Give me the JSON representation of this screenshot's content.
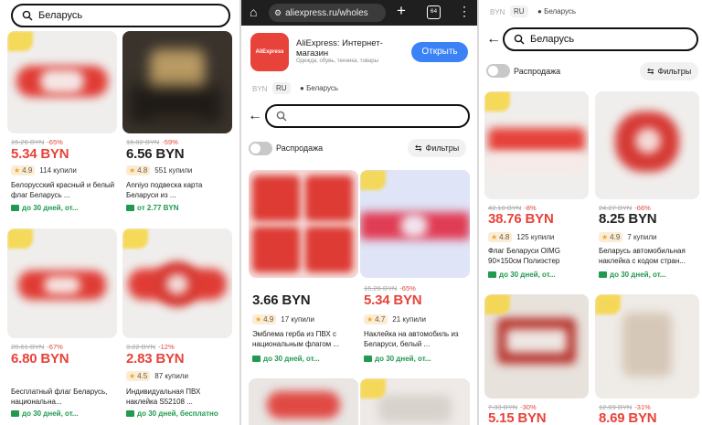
{
  "left": {
    "search_query": "Беларусь",
    "products": [
      {
        "old_price": "15.26 BYN",
        "discount": "-65%",
        "price": "5.34 BYN",
        "price_red": true,
        "rating": "4.9",
        "sold": "114 купили",
        "title": "Белорусский красный и белый флаг Беларусь ...",
        "shipping": "до 30 дней, от..."
      },
      {
        "old_price": "16.02 BYN",
        "discount": "-59%",
        "price": "6.56 BYN",
        "price_red": false,
        "rating": "4.8",
        "sold": "551 купили",
        "title": "Anniyo подвеска карта Беларуси из ...",
        "shipping": "от 2.77 BYN"
      },
      {
        "old_price": "20.61 BYN",
        "discount": "-67%",
        "price": "6.80 BYN",
        "price_red": true,
        "rating": "",
        "sold": "",
        "title": "Бесплатный флаг Беларусь, национальна...",
        "shipping": "до 30 дней, от..."
      },
      {
        "old_price": "3.22 BYN",
        "discount": "-12%",
        "price": "2.83 BYN",
        "price_red": true,
        "rating": "4.5",
        "sold": "87 купили",
        "title": "Индивидуальная ПВХ наклейка S52108 ...",
        "shipping": "до 30 дней, бесплатно"
      }
    ]
  },
  "middle": {
    "browser": {
      "url": "aliexpress.ru/wholes",
      "tab_count": "64"
    },
    "banner": {
      "logo_text": "AliExpress",
      "title": "AliExpress: Интернет-магазин",
      "subtitle": "Одежда, обувь, техника, товары",
      "open_label": "Открыть"
    },
    "region": {
      "currency": "BYN",
      "language": "RU",
      "country": "Беларусь"
    },
    "search_value": "",
    "sale_label": "Распродажа",
    "filters_label": "Фильтры",
    "products": [
      {
        "old_price": "",
        "discount": "",
        "price": "3.66 BYN",
        "price_red": false,
        "rating": "4.9",
        "sold": "17 купили",
        "title": "Эмблема герба из ПВХ с национальным флагом ...",
        "shipping": "до 30 дней, от..."
      },
      {
        "old_price": "15.26 BYN",
        "discount": "-65%",
        "price": "5.34 BYN",
        "price_red": true,
        "rating": "4.7",
        "sold": "21 купили",
        "title": "Наклейка на автомобиль из Беларуси, белый ...",
        "shipping": "до 30 дней, от..."
      }
    ]
  },
  "right": {
    "region": {
      "currency": "BYN",
      "language": "RU",
      "country": "Беларусь"
    },
    "search_query": "Беларусь",
    "sale_label": "Распродажа",
    "filters_label": "Фильтры",
    "products": [
      {
        "old_price": "42.10 BYN",
        "discount": "-8%",
        "price": "38.76 BYN",
        "price_red": true,
        "rating": "4.8",
        "sold": "125 купили",
        "title": "Флаг Беларуси OIMG 90×150см Полиэстер",
        "shipping": "до 30 дней, от..."
      },
      {
        "old_price": "24.27 BYN",
        "discount": "-66%",
        "price": "8.25 BYN",
        "price_red": false,
        "rating": "4.9",
        "sold": "7 купили",
        "title": "Беларусь автомобильная наклейка с кодом стран...",
        "shipping": "до 30 дней, от..."
      },
      {
        "old_price": "7.33 BYN",
        "discount": "-30%",
        "price": "5.15 BYN",
        "price_red": true,
        "rating": "",
        "sold": "",
        "title": "",
        "shipping": ""
      },
      {
        "old_price": "12.69 BYN",
        "discount": "-31%",
        "price": "8.69 BYN",
        "price_red": true,
        "rating": "",
        "sold": "",
        "title": "",
        "shipping": ""
      }
    ]
  },
  "colors": {
    "accent_red": "#e8433a",
    "ship_green": "#1f9a4e",
    "banner_blue": "#3b82f6",
    "browser_bar": "#1f1f1f"
  },
  "icons": [
    "search-icon",
    "back-arrow-icon",
    "home-icon",
    "site-settings-icon",
    "plus-icon",
    "tabs-icon",
    "more-vertical-icon",
    "location-pin-icon",
    "filter-icon",
    "star-icon",
    "truck-icon"
  ]
}
